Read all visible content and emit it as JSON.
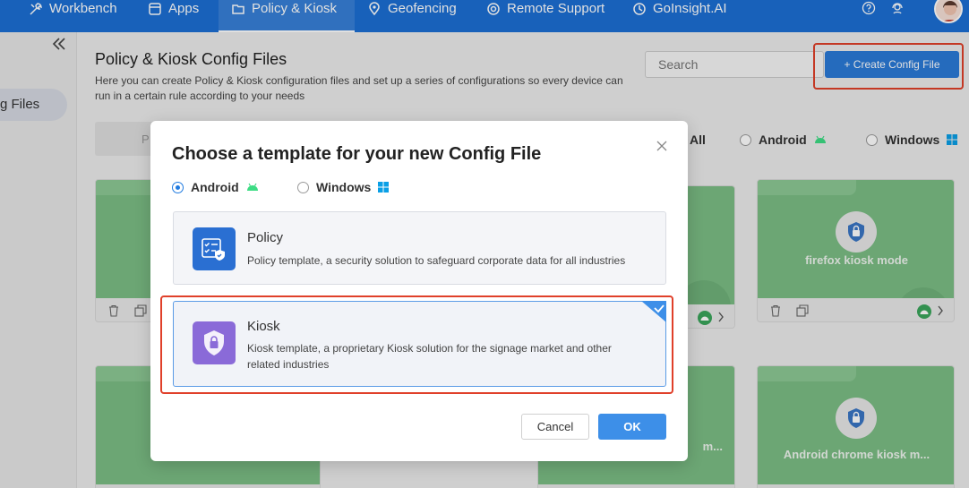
{
  "nav": {
    "items": [
      {
        "label": "Workbench",
        "icon": "tools-icon"
      },
      {
        "label": "Apps",
        "icon": "apps-icon"
      },
      {
        "label": "Policy & Kiosk",
        "icon": "folder-icon"
      },
      {
        "label": "Geofencing",
        "icon": "map-pin-icon"
      },
      {
        "label": "Remote Support",
        "icon": "lifebuoy-icon"
      },
      {
        "label": "GoInsight.AI",
        "icon": "insight-icon"
      }
    ],
    "active": "Policy & Kiosk",
    "right_icons": [
      "help-icon",
      "support-agent-icon",
      "avatar"
    ]
  },
  "sidebar": {
    "active_item_label": "g Files"
  },
  "main": {
    "title": "Policy & Kiosk Config Files",
    "description": "Here you can create Policy & Kiosk configuration files and set up a series of configurations so every device can run in a certain rule according to your needs",
    "search_placeholder": "Search",
    "create_button_label": "+ Create Config File",
    "filter_tab_partial": "P",
    "filter_options": [
      {
        "label": "All"
      },
      {
        "label": "Android",
        "icon": "android-icon"
      },
      {
        "label": "Windows",
        "icon": "windows-icon"
      }
    ],
    "cards": [
      {
        "name": "firefox kiosk mode"
      },
      {
        "name": "Android chrome kiosk m..."
      },
      {
        "name": "m..."
      }
    ]
  },
  "modal": {
    "title": "Choose a template for your new Config File",
    "os_options": [
      {
        "label": "Android",
        "checked": true,
        "icon": "android-icon"
      },
      {
        "label": "Windows",
        "checked": false,
        "icon": "windows-icon"
      }
    ],
    "templates": [
      {
        "name": "Policy",
        "description": "Policy template, a security solution to safeguard corporate data for all industries",
        "icon": "policy-checklist-icon",
        "selected": false
      },
      {
        "name": "Kiosk",
        "description": "Kiosk template, a proprietary Kiosk solution for the signage market and other related industries",
        "icon": "kiosk-lock-shield-icon",
        "selected": true
      }
    ],
    "cancel_label": "Cancel",
    "ok_label": "OK"
  },
  "colors": {
    "nav_bg": "#1c6fd4",
    "primary": "#3d8fe8",
    "highlight": "#e0402a",
    "card_green": "#7bbd85",
    "android_green": "#3ddc84",
    "windows_blue": "#0a9fe6"
  }
}
